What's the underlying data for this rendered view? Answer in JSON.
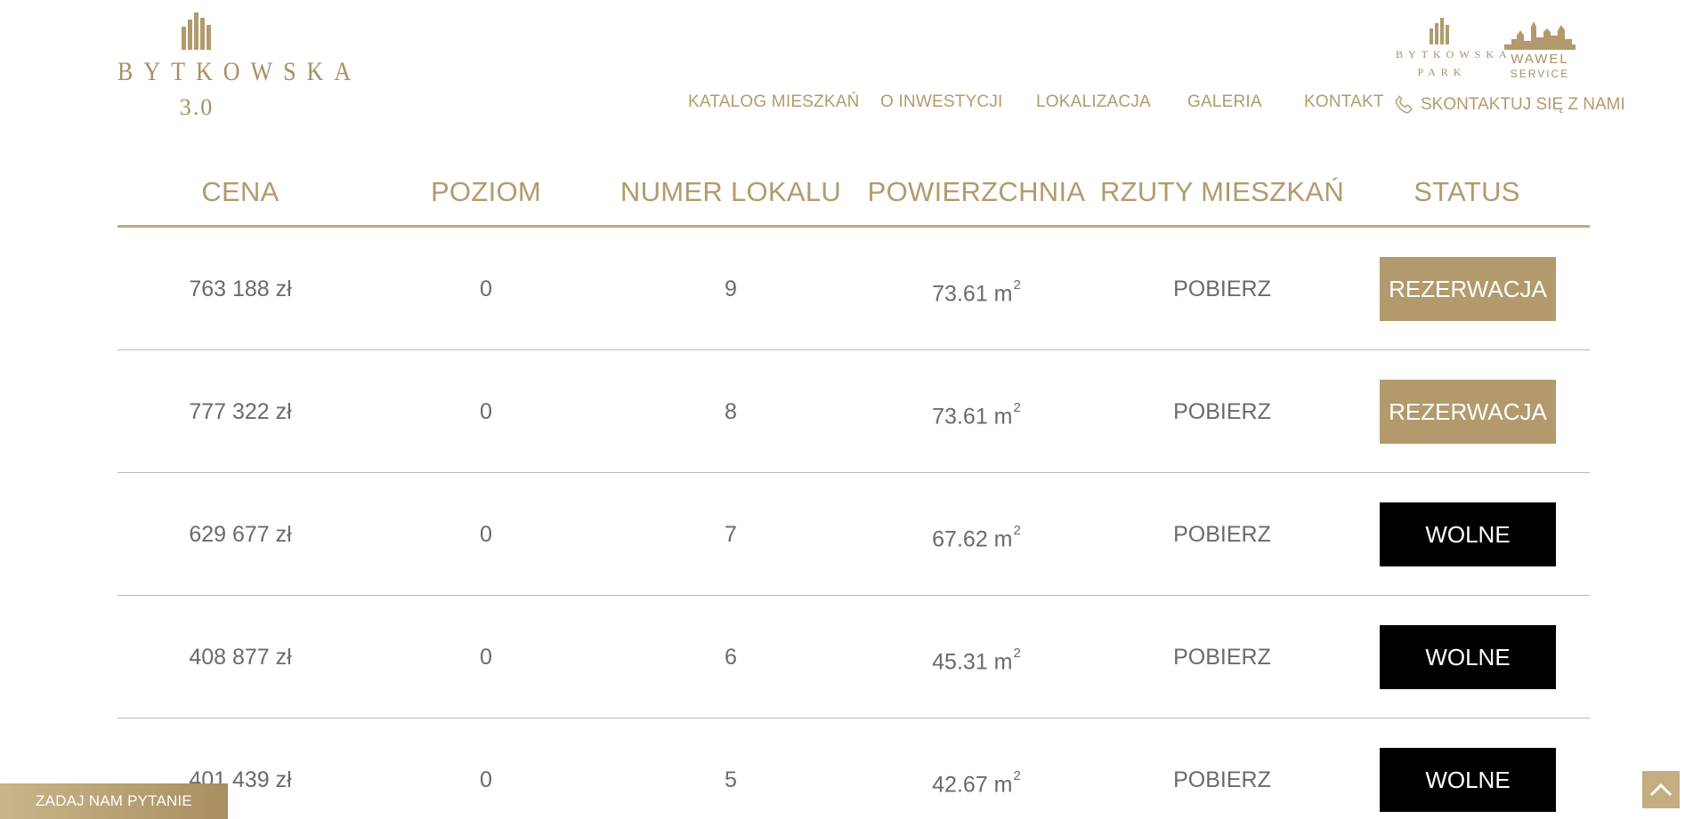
{
  "logo": {
    "word": "BYTKOWSKA",
    "version": "3.0"
  },
  "partners": {
    "park": {
      "line1": "BYTKOWSKA",
      "line2": "PARK"
    },
    "wawel": {
      "line1": "WAWEL",
      "line2": "SERVICE"
    }
  },
  "nav": {
    "items": [
      "KATALOG MIESZKAŃ",
      "O INWESTYCJI",
      "LOKALIZACJA",
      "GALERIA",
      "KONTAKT"
    ],
    "contact": "SKONTAKTUJ SIĘ Z NAMI"
  },
  "table": {
    "headers": [
      "CENA",
      "POZIOM",
      "NUMER LOKALU",
      "POWIERZCHNIA",
      "RZUTY MIESZKAŃ",
      "STATUS"
    ],
    "rows": [
      {
        "price": "763 188 zł",
        "level": "0",
        "number": "9",
        "area": "73.61 m",
        "area_sup": "2",
        "plans": "POBIERZ",
        "status": "REZERWACJA"
      },
      {
        "price": "777 322 zł",
        "level": "0",
        "number": "8",
        "area": "73.61 m",
        "area_sup": "2",
        "plans": "POBIERZ",
        "status": "REZERWACJA"
      },
      {
        "price": "629 677 zł",
        "level": "0",
        "number": "7",
        "area": "67.62 m",
        "area_sup": "2",
        "plans": "POBIERZ",
        "status": "WOLNE"
      },
      {
        "price": "408 877 zł",
        "level": "0",
        "number": "6",
        "area": "45.31 m",
        "area_sup": "2",
        "plans": "POBIERZ",
        "status": "WOLNE"
      },
      {
        "price": "401 439 zł",
        "level": "0",
        "number": "5",
        "area": "42.67 m",
        "area_sup": "2",
        "plans": "POBIERZ",
        "status": "WOLNE"
      }
    ]
  },
  "ask_button": "ZADAJ NAM PYTANIE",
  "colors": {
    "gold": "#b29a6c",
    "reserved_bg": "#b29a6c",
    "free_bg": "#000000",
    "text_gray": "#6a6a6a"
  },
  "icons": {
    "contact": "phone-icon",
    "scroll_top": "chevron-up-icon"
  }
}
